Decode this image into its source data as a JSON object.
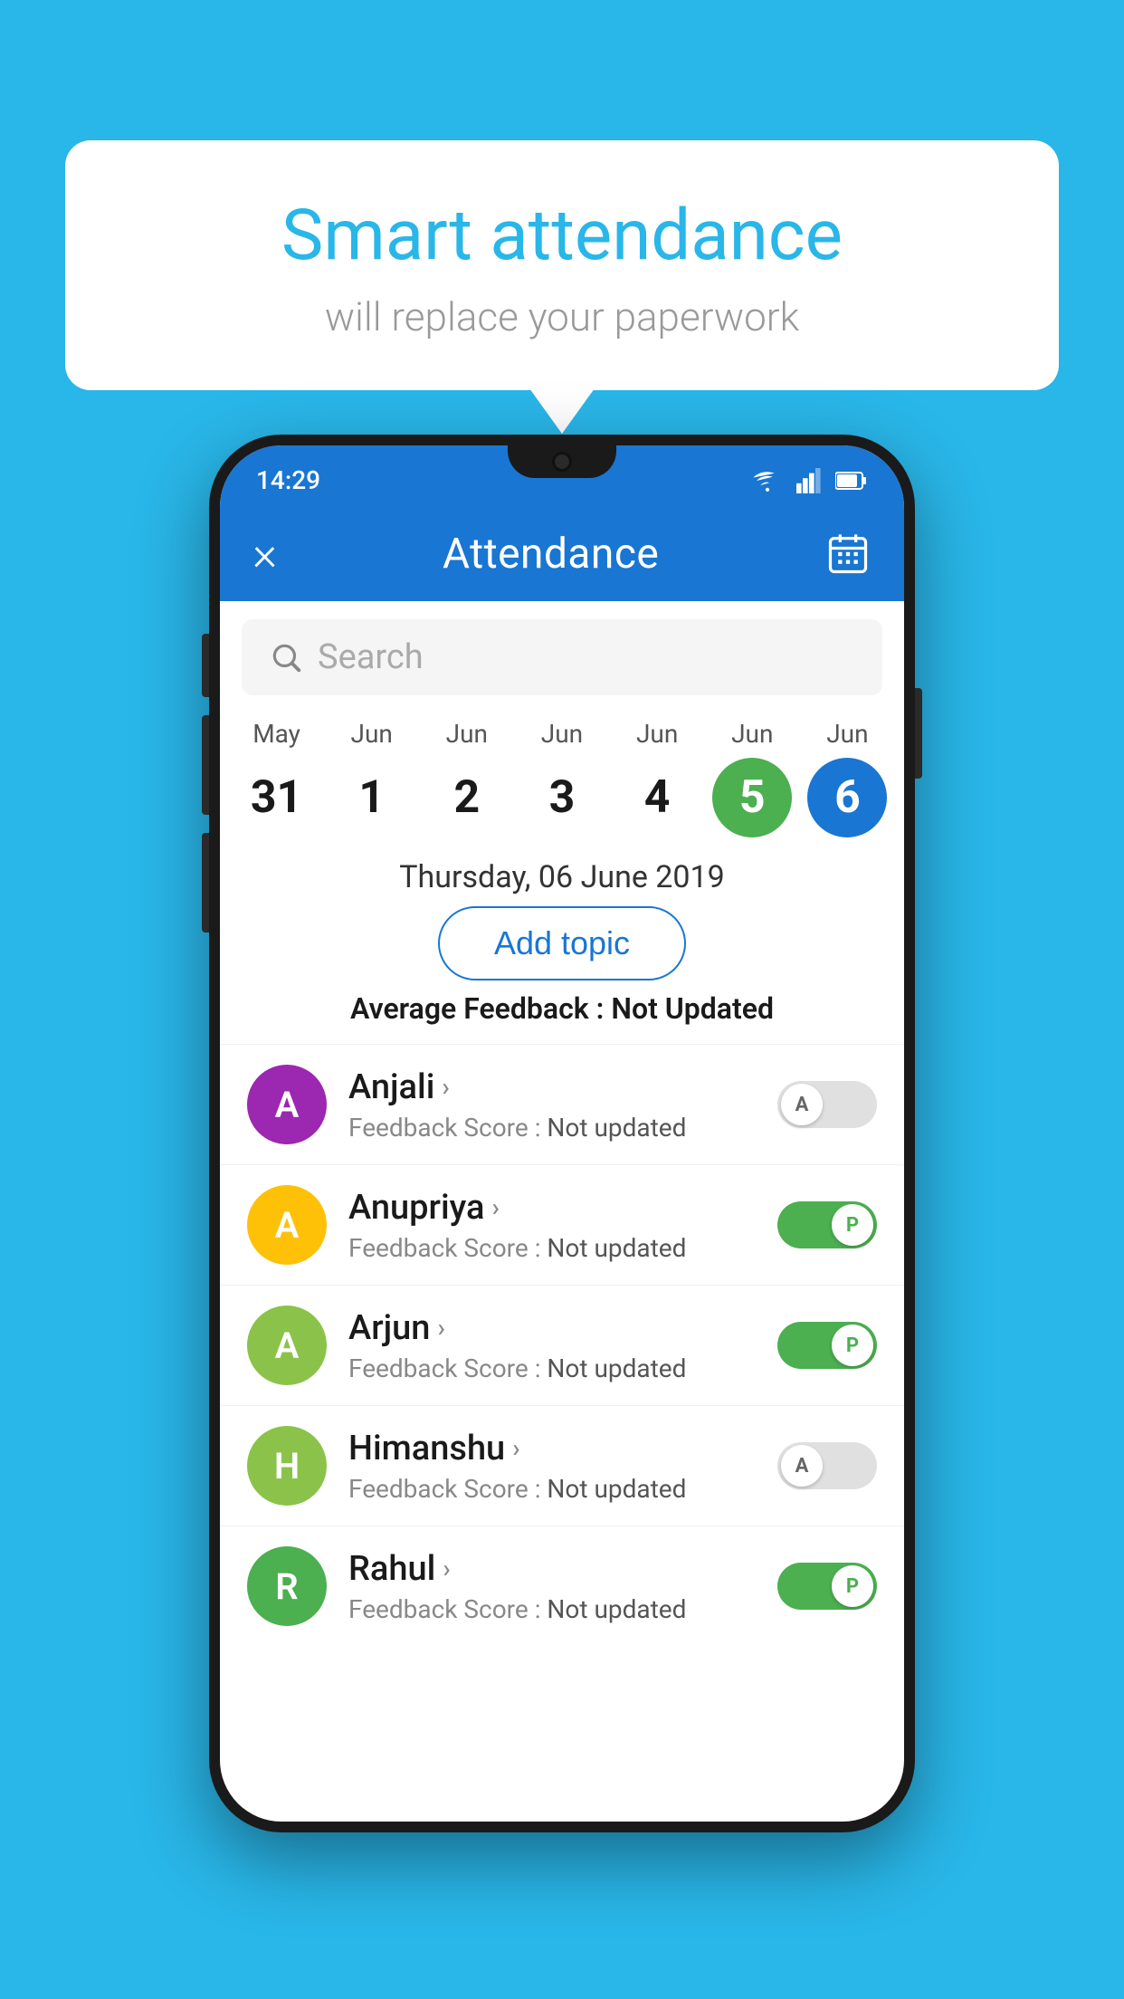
{
  "background_color": "#29b6e8",
  "speech_bubble": {
    "title": "Smart attendance",
    "subtitle": "will replace your paperwork"
  },
  "status_bar": {
    "time": "14:29",
    "wifi_icon": "wifi",
    "signal_icon": "signal",
    "battery_icon": "battery"
  },
  "app_bar": {
    "title": "Attendance",
    "close_label": "×",
    "calendar_label": "calendar"
  },
  "search": {
    "placeholder": "Search"
  },
  "calendar": {
    "days": [
      {
        "month": "May",
        "date": "31",
        "state": "normal"
      },
      {
        "month": "Jun",
        "date": "1",
        "state": "normal"
      },
      {
        "month": "Jun",
        "date": "2",
        "state": "normal"
      },
      {
        "month": "Jun",
        "date": "3",
        "state": "normal"
      },
      {
        "month": "Jun",
        "date": "4",
        "state": "normal"
      },
      {
        "month": "Jun",
        "date": "5",
        "state": "today"
      },
      {
        "month": "Jun",
        "date": "6",
        "state": "selected"
      }
    ]
  },
  "selected_date": "Thursday, 06 June 2019",
  "add_topic_label": "Add topic",
  "avg_feedback": {
    "label": "Average Feedback : ",
    "value": "Not Updated"
  },
  "students": [
    {
      "name": "Anjali",
      "avatar_letter": "A",
      "avatar_color": "#9c27b0",
      "feedback_label": "Feedback Score : ",
      "feedback_value": "Not updated",
      "toggle": "off",
      "toggle_letter": "A"
    },
    {
      "name": "Anupriya",
      "avatar_letter": "A",
      "avatar_color": "#ffc107",
      "feedback_label": "Feedback Score : ",
      "feedback_value": "Not updated",
      "toggle": "on",
      "toggle_letter": "P"
    },
    {
      "name": "Arjun",
      "avatar_letter": "A",
      "avatar_color": "#8bc34a",
      "feedback_label": "Feedback Score : ",
      "feedback_value": "Not updated",
      "toggle": "on",
      "toggle_letter": "P"
    },
    {
      "name": "Himanshu",
      "avatar_letter": "H",
      "avatar_color": "#8bc34a",
      "feedback_label": "Feedback Score : ",
      "feedback_value": "Not updated",
      "toggle": "off",
      "toggle_letter": "A"
    },
    {
      "name": "Rahul",
      "avatar_letter": "R",
      "avatar_color": "#4caf50",
      "feedback_label": "Feedback Score : ",
      "feedback_value": "Not updated",
      "toggle": "on",
      "toggle_letter": "P"
    }
  ]
}
